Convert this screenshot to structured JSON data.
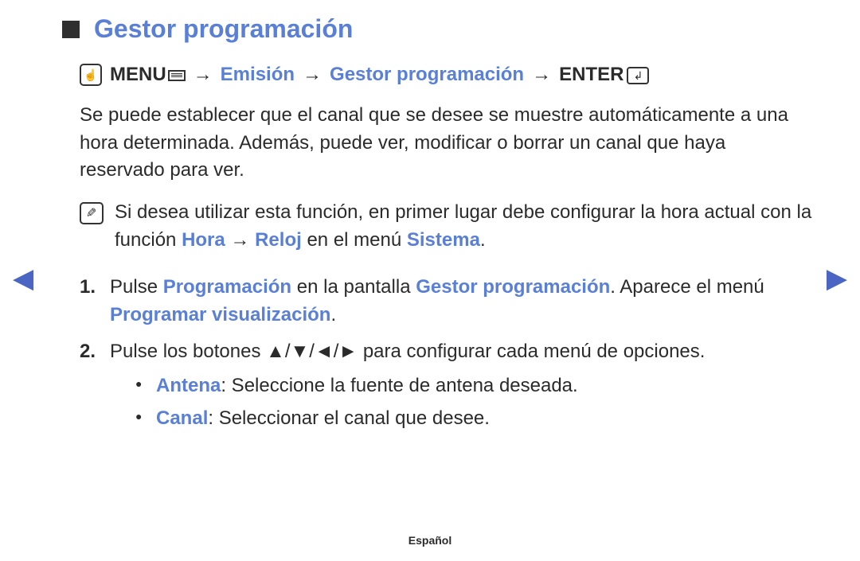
{
  "title": "Gestor programación",
  "path": {
    "menu_word": "MENU",
    "crumb1": "Emisión",
    "crumb2": "Gestor programación",
    "enter_word": "ENTER",
    "sep": "→"
  },
  "intro": "Se puede establecer que el canal que se desee se muestre automáticamente a una hora determinada. Además, puede ver, modificar o borrar un canal que haya reservado para ver.",
  "note": {
    "pre": "Si desea utilizar esta función, en primer lugar debe configurar la hora actual con la función ",
    "hora": "Hora",
    "sep1": " → ",
    "reloj": "Reloj",
    "mid": " en el menú ",
    "sistema": "Sistema",
    "end": "."
  },
  "steps": {
    "s1": {
      "t1": "Pulse ",
      "programacion": "Programación",
      "t2": " en la pantalla ",
      "gestor": "Gestor programación",
      "t3": ". Aparece el menú ",
      "programar_vis": "Programar visualización",
      "t4": "."
    },
    "s2": {
      "t1": "Pulse los botones ",
      "arrows": "▲/▼/◄/►",
      "t2": " para configurar cada menú de opciones."
    }
  },
  "bullets": {
    "antena_label": "Antena",
    "antena_text": ": Seleccione la fuente de antena deseada.",
    "canal_label": "Canal",
    "canal_text": ": Seleccionar el canal que desee."
  },
  "footer": "Español",
  "icons": {
    "hand": "☝",
    "enter": "↲"
  }
}
